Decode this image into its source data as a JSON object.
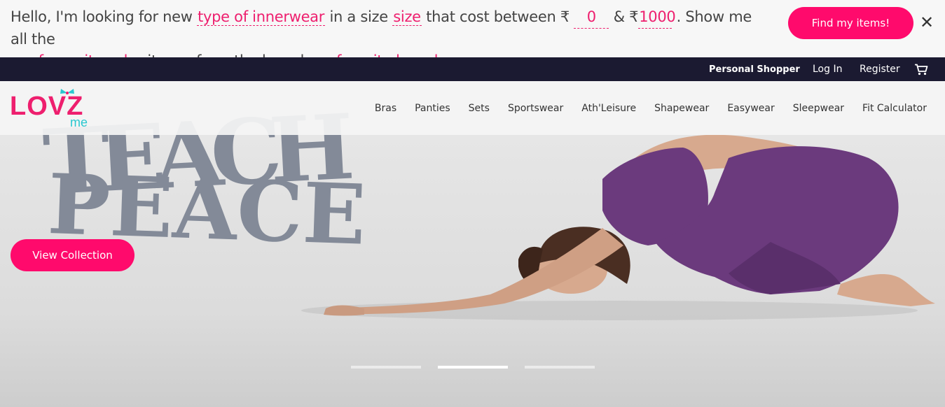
{
  "shopper": {
    "intro": "Hello, I'm looking for new",
    "type_field": "type of innerwear",
    "size_prefix": "in a size",
    "size_field": "size",
    "cost_prefix": "that cost between",
    "currency1": "₹",
    "min_value": "0",
    "amp": "&",
    "currency2": "₹",
    "max_value": "1000",
    "show_text": ". Show me all the",
    "color_field": "my favourite color",
    "brand_prefix": "items, from the brand",
    "brand_field": "my favorite brand",
    "find_label": "Find my items!",
    "close_glyph": "✕"
  },
  "account": {
    "personal_shopper": "Personal Shopper",
    "login": "Log In",
    "register": "Register",
    "cart_icon": "cart-icon"
  },
  "logo": {
    "main": "LOVZ",
    "sub": "me"
  },
  "nav": {
    "items": [
      "Bras",
      "Panties",
      "Sets",
      "Sportswear",
      "Ath'Leisure",
      "Shapewear",
      "Easywear",
      "Sleepwear",
      "Fit Calculator"
    ]
  },
  "hero": {
    "graphic_text_line1": "TEACH",
    "graphic_text_line2": "PEACE",
    "cta": "View Collection",
    "slides_total": 3,
    "active_slide": 2
  },
  "colors": {
    "accent": "#ff0a6c",
    "nav_dark": "#1b1a31",
    "logo_pink": "#ee1f6e",
    "logo_teal": "#29c7cf",
    "outfit_purple": "#6b3a7d"
  }
}
